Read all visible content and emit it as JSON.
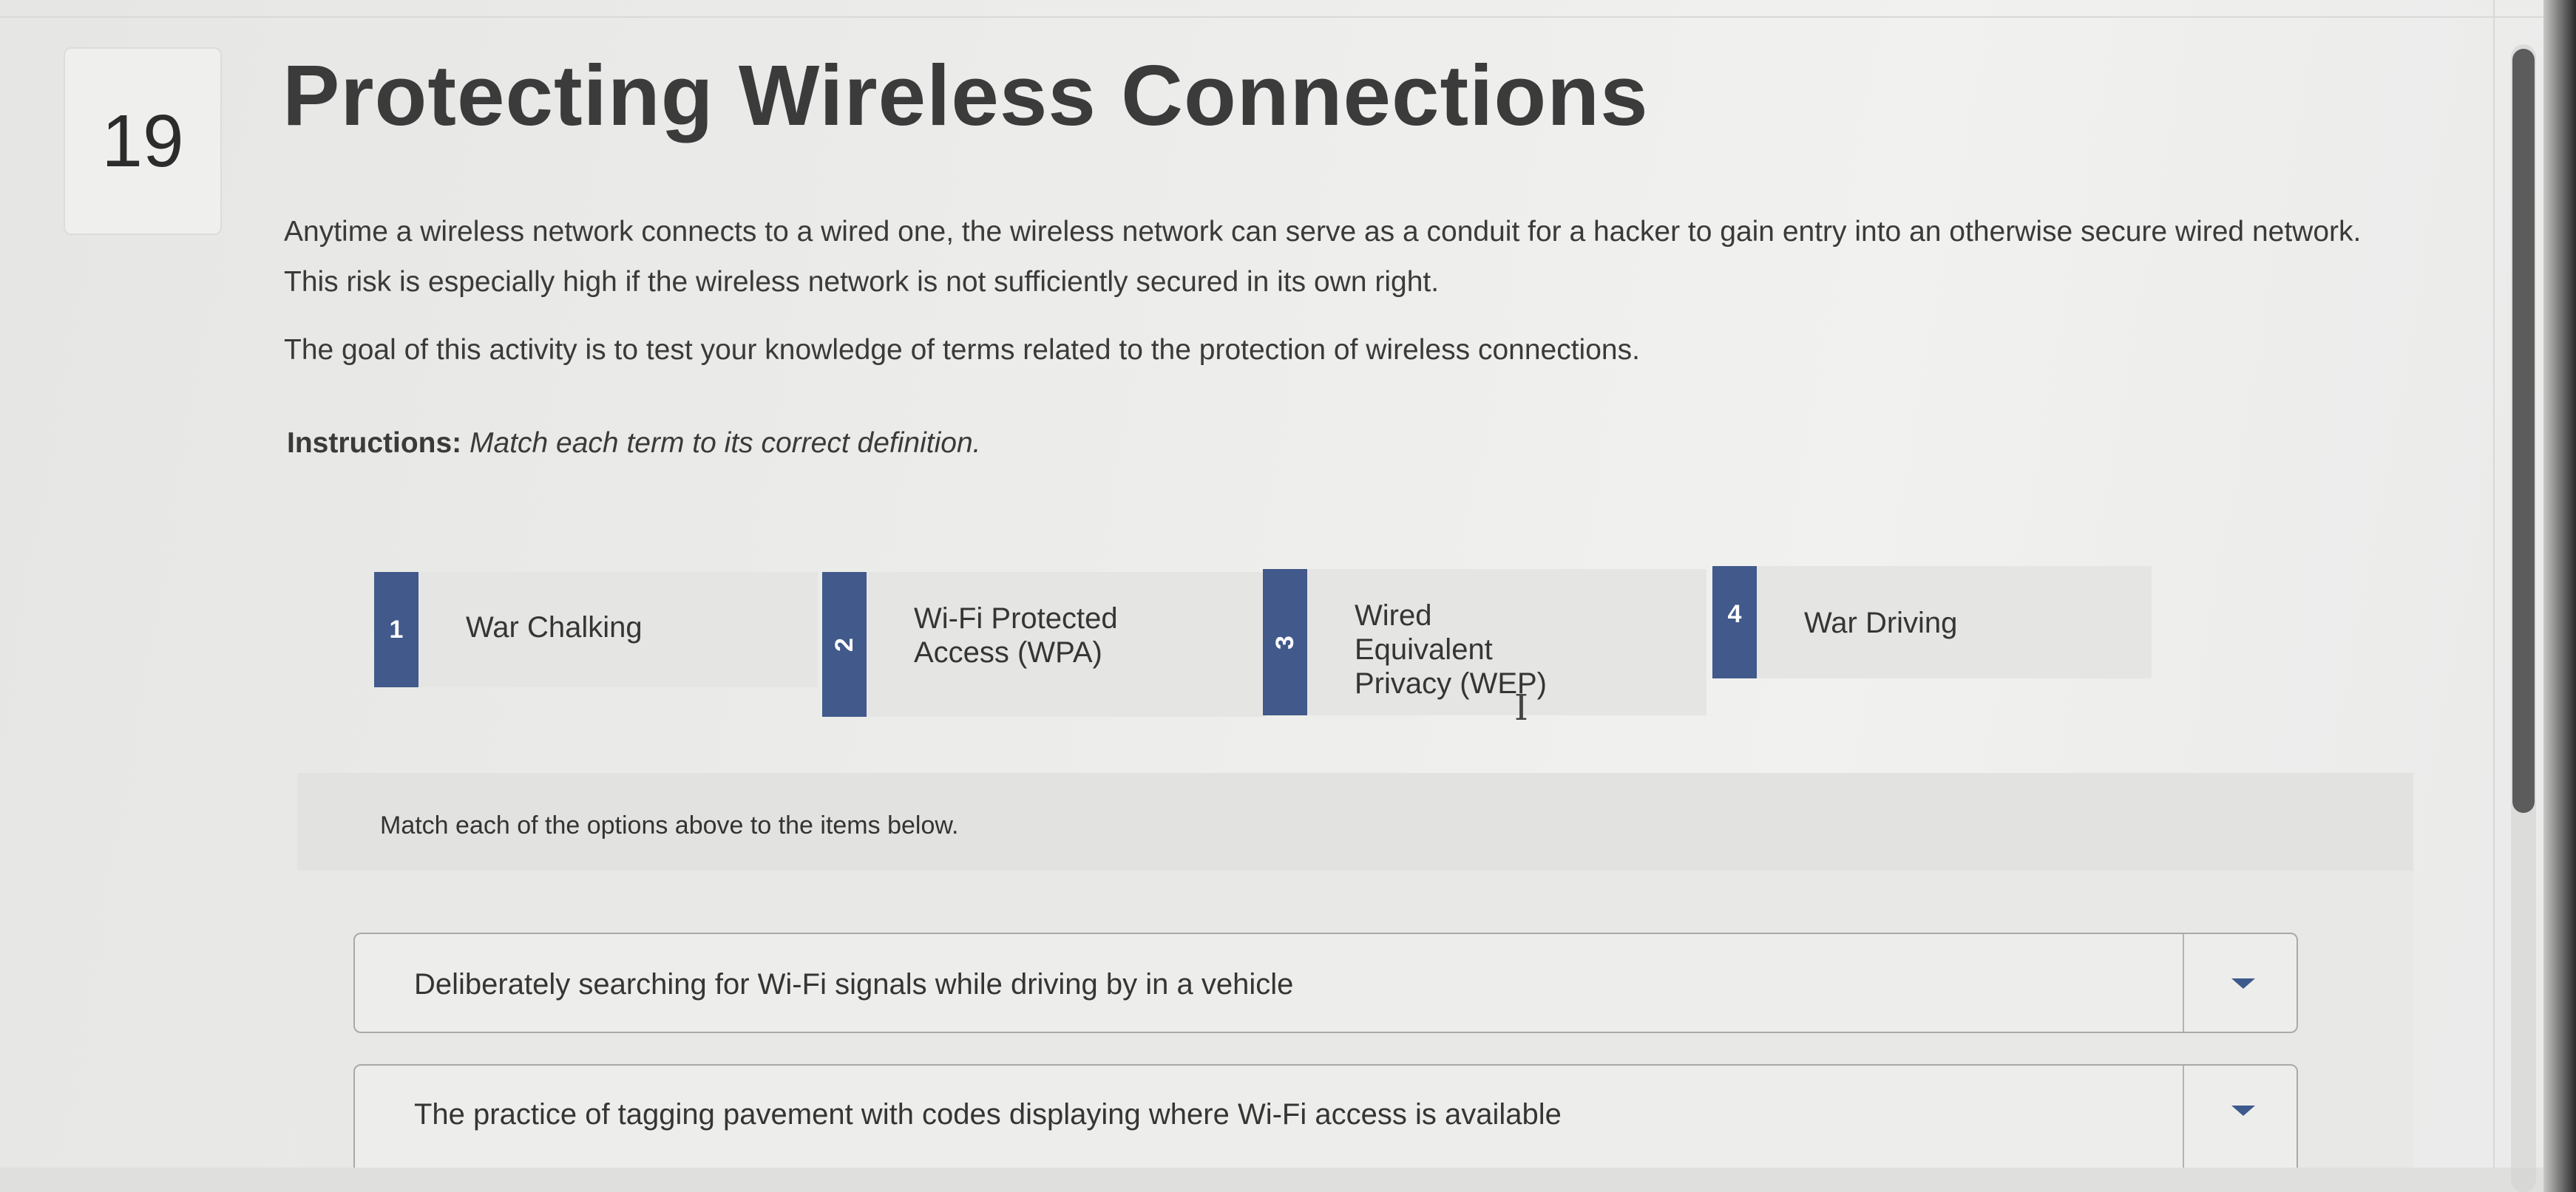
{
  "question": {
    "number": "19",
    "title": "Protecting Wireless Connections"
  },
  "intro": {
    "paragraph": "Anytime a wireless network connects to a wired one, the wireless network can serve as a conduit for a hacker to gain entry into an otherwise secure wired network. This risk is especially high if the wireless network is not sufficiently secured in its own right.",
    "goal": "The goal of this activity is to test your knowledge of terms related to the protection of wireless connections.",
    "instructions_label": "Instructions:",
    "instructions_text": "Match each term to its correct definition."
  },
  "terms": [
    {
      "number": "1",
      "label": "War Chalking"
    },
    {
      "number": "2",
      "label": "Wi-Fi Protected Access (WPA)"
    },
    {
      "number": "3",
      "label": "Wired Equivalent Privacy (WEP)"
    },
    {
      "number": "4",
      "label": "War Driving"
    }
  ],
  "matching": {
    "prompt": "Match each of the options above to the items below.",
    "items": [
      {
        "text": "Deliberately searching for Wi-Fi signals while driving by in a vehicle"
      },
      {
        "text": "The practice of tagging pavement with codes displaying where Wi-Fi access is available"
      }
    ]
  },
  "colors": {
    "accent": "#41598b",
    "dropdown_arrow": "#3d5a8c"
  },
  "icons": {
    "cursor": "text-cursor-icon",
    "dropdown": "caret-down-icon"
  }
}
